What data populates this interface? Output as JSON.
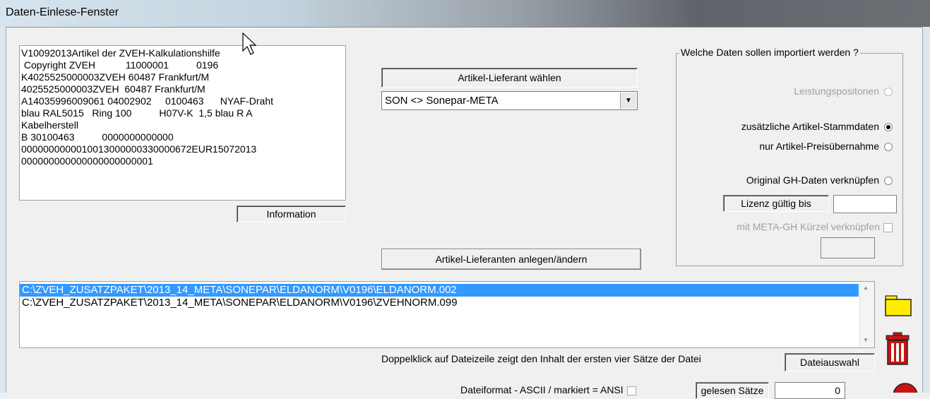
{
  "window": {
    "title": "Daten-Einlese-Fenster"
  },
  "preview": {
    "lines": [
      "V10092013Artikel der ZVEH-Kalkulationshilfe",
      " Copyright ZVEH           11000001          0196",
      "K4025525000003ZVEH 60487 Frankfurt/M",
      "4025525000003ZVEH  60487 Frankfurt/M",
      "",
      "A14035996009061 04002902     0100463      NYAF-Draht",
      "blau RAL5015   Ring 100          H07V-K  1,5 blau R A",
      "Kabelherstell",
      "B 30100463          0000000000000",
      "0000000000010013000000330000672EUR15072013",
      "000000000000000000000001"
    ],
    "info_label": "Information"
  },
  "supplier": {
    "label": "Artikel-Lieferant wählen",
    "selected": "SON <> Sonepar-META",
    "manage_button": "Artikel-Lieferanten anlegen/ändern"
  },
  "import_group": {
    "legend": "Welche Daten sollen importiert werden ?",
    "options": [
      {
        "label": "Leistungspositonen",
        "state": "disabled"
      },
      {
        "label": "zusätzliche Artikel-Stammdaten",
        "state": "checked"
      },
      {
        "label": "nur Artikel-Preisübernahme",
        "state": "unchecked"
      },
      {
        "label": "Original GH-Daten verknüpfen",
        "state": "unchecked"
      }
    ],
    "license_label": "Lizenz gültig bis",
    "license_value": "",
    "meta_label": "mit META-GH Kürzel verknüpfen",
    "meta_value": ""
  },
  "files": {
    "rows": [
      {
        "path": "C:\\ZVEH_ZUSATZPAKET\\2013_14_META\\SONEPAR\\ELDANORM\\V0196\\ELDANORM.002",
        "selected": true
      },
      {
        "path": "C:\\ZVEH_ZUSATZPAKET\\2013_14_META\\SONEPAR\\ELDANORM\\V0196\\ZVEHNORM.099",
        "selected": false
      }
    ],
    "hint": "Doppelklick auf Dateizeile zeigt den Inhalt der ersten vier Sätze der Datei",
    "select_label": "Dateiauswahl"
  },
  "bottom": {
    "format_label": "Dateiformat - ASCII / markiert = ANSI",
    "read_label": "gelesen Sätze",
    "read_value": "0"
  },
  "colors": {
    "selection": "#3399ff",
    "folder": "#ffee00",
    "trash": "#c81414"
  }
}
